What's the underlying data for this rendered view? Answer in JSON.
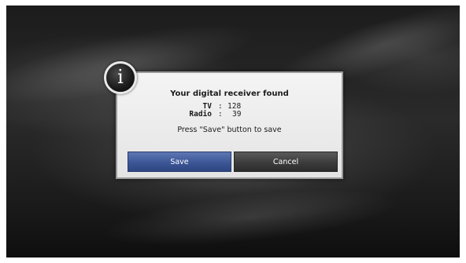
{
  "dialog": {
    "title": "Your digital receiver found",
    "counts": [
      {
        "label": "TV",
        "separator": ":",
        "value": "128"
      },
      {
        "label": "Radio",
        "separator": ":",
        "value": "39"
      }
    ],
    "prompt": "Press \"Save\" button to save",
    "badge_glyph": "i",
    "badge_icon": "info-icon",
    "buttons": {
      "save_label": "Save",
      "cancel_label": "Cancel"
    }
  },
  "colors": {
    "save_button": "#3c5697",
    "cancel_button": "#3c3c3c",
    "dialog_background": "#ececec",
    "screen_background": "#1e1e1e"
  }
}
